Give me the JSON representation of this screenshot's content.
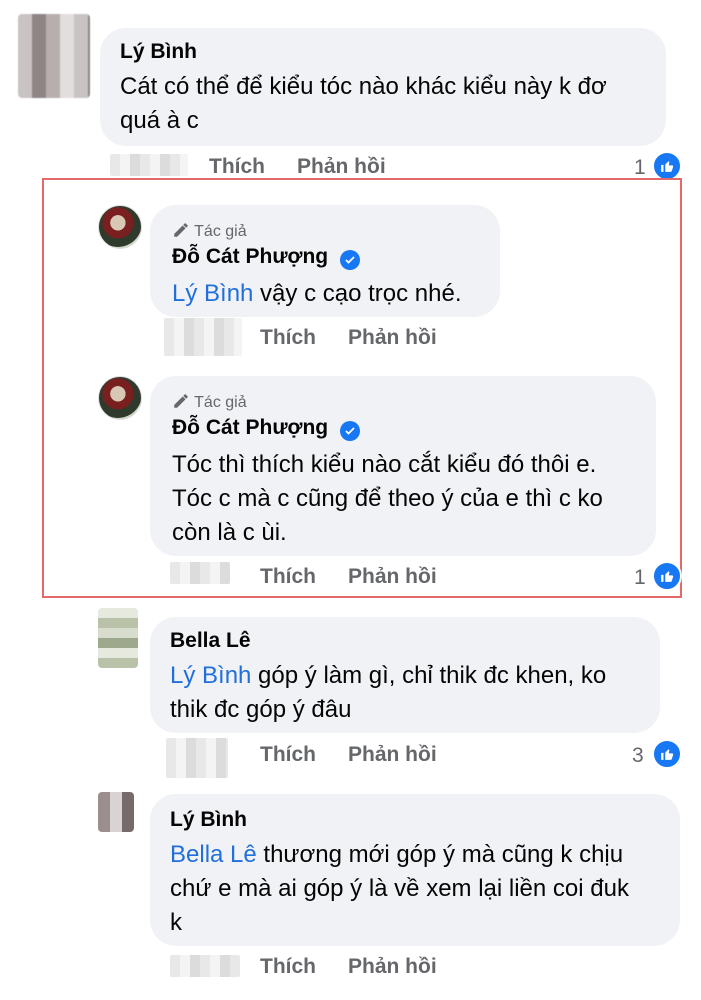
{
  "comments": [
    {
      "name": "Lý Bình",
      "text": "Cát có thể để kiểu tóc nào khác kiểu này k đơ quá à c",
      "like_label": "Thích",
      "reply_label": "Phản hồi",
      "likes": "1"
    },
    {
      "tag": "Tác giả",
      "name": "Đỗ Cát Phượng",
      "mention": "Lý Bình",
      "text": " vậy c cạo trọc nhé.",
      "like_label": "Thích",
      "reply_label": "Phản hồi"
    },
    {
      "tag": "Tác giả",
      "name": "Đỗ Cát Phượng",
      "text_line1": "Tóc thì thích kiểu nào cắt kiểu đó thôi e.",
      "text_line2": "Tóc c mà c cũng để theo ý của e thì c ko",
      "text_line3": "còn là c ùi.",
      "like_label": "Thích",
      "reply_label": "Phản hồi",
      "likes": "1"
    },
    {
      "name": "Bella Lê",
      "mention": "Lý Bình",
      "text_line1": " góp ý làm gì, chỉ thik đc khen, ko",
      "text_line2": "thik đc góp ý đâu",
      "like_label": "Thích",
      "reply_label": "Phản hồi",
      "likes": "3"
    },
    {
      "name": "Lý Bình",
      "mention": "Bella Lê",
      "text_line1": " thương mới góp ý mà cũng k chịu",
      "text_line2": "chứ e mà ai góp ý là về xem lại liền coi đuk",
      "text_line3": "k",
      "like_label": "Thích",
      "reply_label": "Phản hồi"
    }
  ],
  "colors": {
    "bubble": "#f0f2f5",
    "mention": "#216fdb",
    "like_blue": "#1877f2",
    "highlight": "#e46a6a",
    "secondary_text": "#65676b"
  }
}
